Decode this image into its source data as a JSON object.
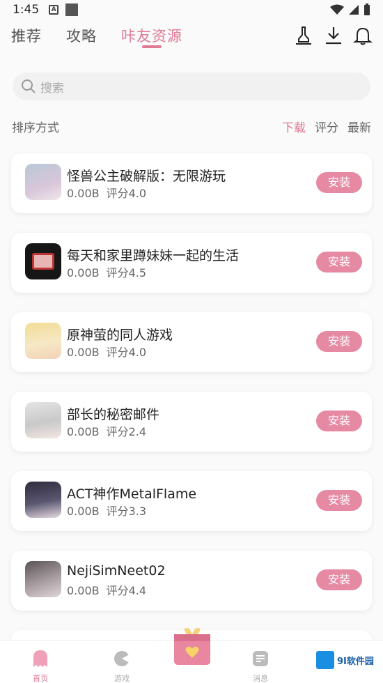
{
  "status_bar": {
    "time": "1:45",
    "badge_letter": "A"
  },
  "top_nav": {
    "tabs": [
      {
        "label": "推荐",
        "active": false
      },
      {
        "label": "攻略",
        "active": false
      },
      {
        "label": "咔友资源",
        "active": true
      }
    ],
    "icons": [
      "broom-icon",
      "download-icon",
      "bell-icon"
    ]
  },
  "search": {
    "placeholder": "搜索"
  },
  "sort": {
    "label": "排序方式",
    "options": [
      {
        "label": "下载",
        "active": true
      },
      {
        "label": "评分",
        "active": false
      },
      {
        "label": "最新",
        "active": false
      }
    ]
  },
  "apps": [
    {
      "name": "怪兽公主破解版：无限游玩",
      "size": "0.00B",
      "rating": "评分4.0",
      "action": "安装",
      "thumb_color": "#c9c3d6"
    },
    {
      "name": "每天和家里蹲妹妹一起的生活",
      "size": "0.00B",
      "rating": "评分4.5",
      "action": "安装",
      "thumb_color": "#1c1c1c"
    },
    {
      "name": "原神萤的同人游戏",
      "size": "0.00B",
      "rating": "评分4.0",
      "action": "安装",
      "thumb_color": "#f0d790"
    },
    {
      "name": "部长的秘密邮件",
      "size": "0.00B",
      "rating": "评分2.4",
      "action": "安装",
      "thumb_color": "#cfcfcf"
    },
    {
      "name": "ACT神作MetalFlame",
      "size": "0.00B",
      "rating": "评分3.3",
      "action": "安装",
      "thumb_color": "#3b3a4e"
    },
    {
      "name": "NejiSimNeet02",
      "size": "0.00B",
      "rating": "评分4.4",
      "action": "安装",
      "thumb_color": "#8f8688"
    }
  ],
  "bottom_nav": [
    {
      "label": "首页",
      "icon": "ghost-icon",
      "active": true
    },
    {
      "label": "游戏",
      "icon": "gamepad-icon",
      "active": false
    },
    {
      "label": "",
      "icon": "gift-icon",
      "active": false
    },
    {
      "label": "消息",
      "icon": "message-icon",
      "active": false
    }
  ],
  "watermark": {
    "text": "9I软件园"
  },
  "colors": {
    "accent": "#e07a95",
    "install_button": "#e68aa4"
  }
}
